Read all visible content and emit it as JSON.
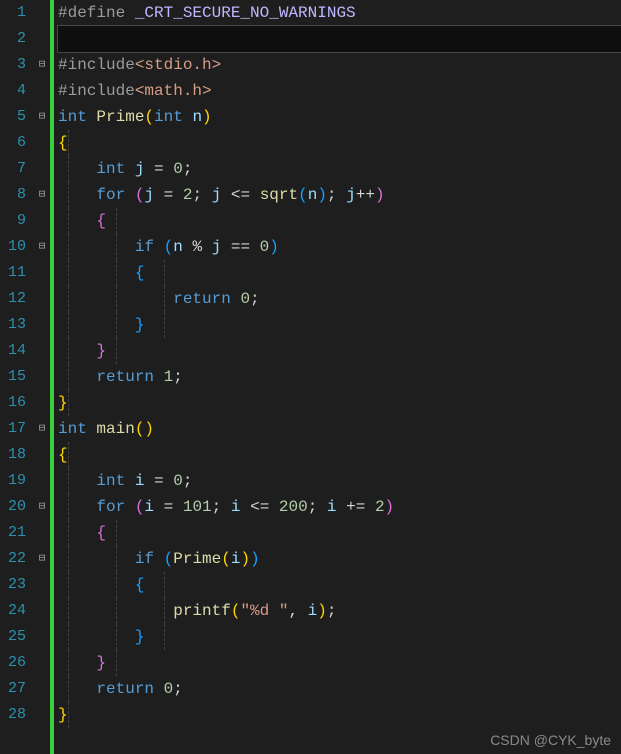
{
  "watermark": "CSDN @CYK_byte",
  "line_numbers": [
    "1",
    "2",
    "3",
    "4",
    "5",
    "6",
    "7",
    "8",
    "9",
    "10",
    "11",
    "12",
    "13",
    "14",
    "15",
    "16",
    "17",
    "18",
    "19",
    "20",
    "21",
    "22",
    "23",
    "24",
    "25",
    "26",
    "27",
    "28"
  ],
  "fold_markers": {
    "3": "⊟",
    "5": "⊟",
    "8": "⊟",
    "10": "⊟",
    "17": "⊟",
    "20": "⊟",
    "22": "⊟"
  },
  "tokens": {
    "define": "#define ",
    "macro": "_CRT_SECURE_NO_WARNINGS",
    "include": "#include",
    "hdr1": "<stdio.h>",
    "hdr2": "<math.h>",
    "int": "int ",
    "prime": "Prime",
    "main": "main",
    "printf": "printf",
    "sqrt": "sqrt",
    "for": "for ",
    "if": "if ",
    "return": "return ",
    "n": "n",
    "j": "j",
    "i": "i",
    "zero": "0",
    "one": "1",
    "two": "2",
    "n101": "101",
    "n200": "200",
    "semi": ";",
    "comma": ", ",
    "eq": " = ",
    "le": " <= ",
    "pe": " += ",
    "pp": "++",
    "mod": " % ",
    "eqeq": " == ",
    "lp": "(",
    "rp": ")",
    "lb": "{",
    "rb": "}",
    "lt": "<",
    "gt": ">",
    "fmt": "\"%d \""
  },
  "guides": {
    "1": [],
    "2": [],
    "3": [],
    "4": [],
    "5": [],
    "6": [
      1
    ],
    "7": [
      1
    ],
    "8": [
      1
    ],
    "9": [
      1,
      2
    ],
    "10": [
      1,
      2
    ],
    "11": [
      1,
      2,
      3
    ],
    "12": [
      1,
      2,
      3
    ],
    "13": [
      1,
      2,
      3
    ],
    "14": [
      1,
      2
    ],
    "15": [
      1
    ],
    "16": [
      1
    ],
    "17": [],
    "18": [
      1
    ],
    "19": [
      1
    ],
    "20": [
      1
    ],
    "21": [
      1,
      2
    ],
    "22": [
      1,
      2
    ],
    "23": [
      1,
      2,
      3
    ],
    "24": [
      1,
      2,
      3
    ],
    "25": [
      1,
      2,
      3
    ],
    "26": [
      1,
      2
    ],
    "27": [
      1
    ],
    "28": [
      1
    ]
  }
}
